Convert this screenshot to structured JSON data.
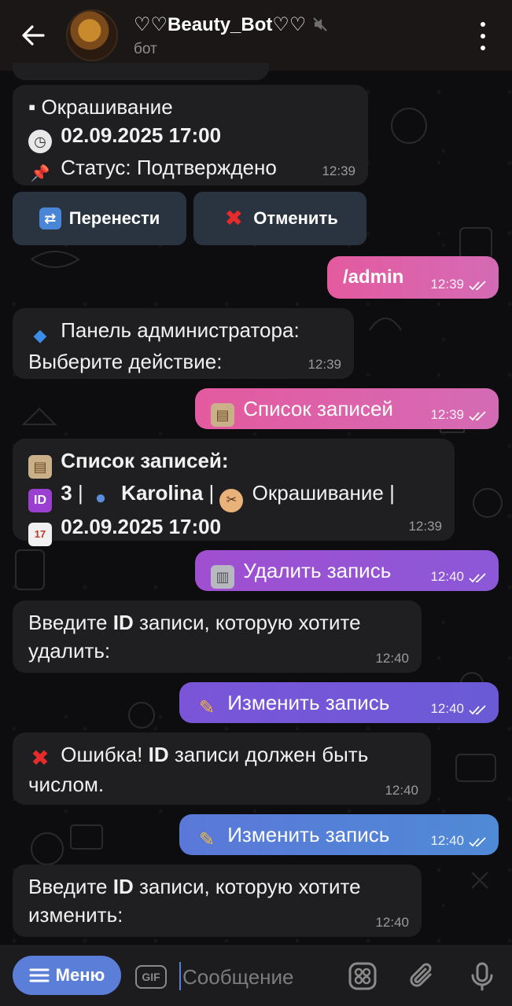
{
  "header": {
    "title": "♡♡Beauty_Bot♡♡",
    "subtitle": "бот",
    "icons": [
      "back-arrow-icon",
      "mute-icon",
      "more-vert-icon"
    ]
  },
  "messages": {
    "m1": {
      "line1": "▪ Окрашивание",
      "line2": "02.09.2025 17:00",
      "line3": "Статус: Подтверждено",
      "time": "12:39",
      "icons": [
        "clock-icon",
        "pin-icon"
      ]
    },
    "buttons": {
      "reschedule": "Перенести",
      "cancel": "Отменить"
    },
    "m2": {
      "text": "/admin",
      "time": "12:39"
    },
    "m3": {
      "line1": "Панель администратора:",
      "line2": "Выберите действие:",
      "time": "12:39"
    },
    "m4": {
      "text": "Список записей",
      "time": "12:39"
    },
    "m5": {
      "line1": "Список записей:",
      "id_badge": "ID",
      "id": "3",
      "sep1": "|",
      "name": "Karolina",
      "sep2": "|",
      "service": "Окрашивание",
      "sep3": "|",
      "datetime": "02.09.2025 17:00",
      "time": "12:39"
    },
    "m6": {
      "text": "Удалить запись",
      "time": "12:40"
    },
    "m7": {
      "line1_a": "Введите ",
      "line1_b": "ID",
      "line1_c": " записи, которую хотите",
      "line2": "удалить:",
      "time": "12:40"
    },
    "m8": {
      "text": "Изменить запись",
      "time": "12:40"
    },
    "m9": {
      "line1_a": "Ошибка! ",
      "line1_b": "ID",
      "line1_c": " записи должен быть",
      "line2": "числом.",
      "time": "12:40"
    },
    "m10": {
      "text": "Изменить запись",
      "time": "12:40"
    },
    "m11": {
      "line1_a": "Введите ",
      "line1_b": "ID",
      "line1_c": " записи, которую хотите",
      "line2": "изменить:",
      "time": "12:40"
    }
  },
  "inputbar": {
    "menu_label": "Меню",
    "gif_label": "GIF",
    "placeholder": "Сообщение",
    "icons": [
      "sticker-grid-icon",
      "attach-icon",
      "mic-icon"
    ]
  },
  "colors": {
    "accent": "#5b7fd8",
    "incoming": "#1f1f21",
    "outgoing_pink": "#e45a9f",
    "outgoing_purple": "#a04fd0",
    "outgoing_violet": "#7b55d8",
    "outgoing_blue": "#5a78d8",
    "inline_button": "#2a3440"
  }
}
